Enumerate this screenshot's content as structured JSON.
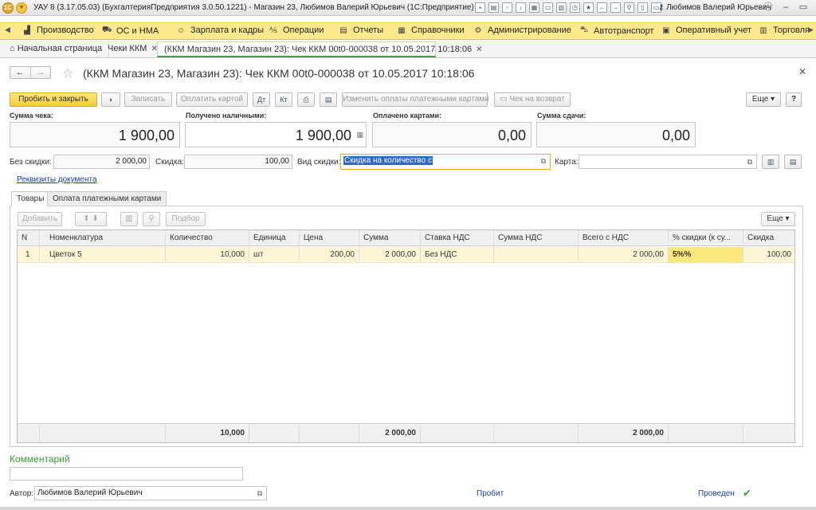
{
  "window": {
    "title": "УАУ 8 (3.17.05.03) (БухгалтерияПредприятия 3.0.50.1221) - Магазин 23, Любимов Валерий Юрьевич  (1С:Предприятие)",
    "user": "Любимов Валерий Юрьевич"
  },
  "sections": [
    {
      "label": "Производство",
      "icon": "factory-icon",
      "glyph": "▟"
    },
    {
      "label": "ОС и НМА",
      "icon": "truck-icon",
      "glyph": "⛟"
    },
    {
      "label": "Зарплата и кадры",
      "icon": "people-icon",
      "glyph": "☺"
    },
    {
      "label": "Операции",
      "icon": "operations-icon",
      "glyph": "⅍"
    },
    {
      "label": "Отчеты",
      "icon": "reports-icon",
      "glyph": "▤"
    },
    {
      "label": "Справочники",
      "icon": "books-icon",
      "glyph": "▦"
    },
    {
      "label": "Администрирование",
      "icon": "gear-icon",
      "glyph": "⚙"
    },
    {
      "label": "Автотранспорт",
      "icon": "car-icon",
      "glyph": "⛍"
    },
    {
      "label": "Оперативный учет",
      "icon": "accounting-icon",
      "glyph": "▣"
    },
    {
      "label": "Торговля",
      "icon": "trade-icon",
      "glyph": "▥"
    }
  ],
  "window_tabs": {
    "home": "Начальная страница",
    "checks": "Чеки ККМ",
    "current": "(ККМ Магазин 23, Магазин 23): Чек ККМ 00t0-000038 от 10.05.2017 10:18:06"
  },
  "form": {
    "title": "(ККМ Магазин 23, Магазин 23): Чек ККМ 00t0-000038 от 10.05.2017 10:18:06"
  },
  "toolbar": {
    "print_close": "Пробить и закрыть",
    "save": "Записать",
    "pay_card": "Оплатить картой",
    "change_card_payments": "Изменить оплаты платежными картами",
    "return_check": "Чек на возврат",
    "more": "Еще",
    "help": "?"
  },
  "sums": {
    "check_sum_label": "Сумма чека:",
    "check_sum": "1 900,00",
    "cash_label": "Получено наличными:",
    "cash": "1 900,00",
    "cards_label": "Оплачено картами:",
    "cards": "0,00",
    "change_label": "Сумма сдачи:",
    "change": "0,00"
  },
  "discounts": {
    "no_discount_label": "Без скидки:",
    "no_discount": "2 000,00",
    "discount_label": "Скидка:",
    "discount": "100,00",
    "type_label": "Вид скидки:",
    "type": "Скидка на количество с",
    "card_label": "Карта:",
    "card": ""
  },
  "requisites_link": "Реквизиты документа",
  "inner_tabs": {
    "goods": "Товары",
    "card_payments": "Оплата платежными картами"
  },
  "table_toolbar": {
    "add": "Добавить",
    "pick": "Подбор",
    "more": "Еще"
  },
  "table": {
    "columns": [
      "N",
      "Номенклатура",
      "Количество",
      "Единица",
      "Цена",
      "Сумма",
      "Ставка НДС",
      "Сумма НДС",
      "Всего с НДС",
      "% скидки (к су...",
      "Скидка"
    ],
    "rows": [
      [
        "1",
        "Цветок 5",
        "10,000",
        "шт",
        "200,00",
        "2 000,00",
        "Без НДС",
        "",
        "2 000,00",
        "5%%",
        "100,00"
      ]
    ],
    "totals": [
      "",
      "",
      "10,000",
      "",
      "",
      "2 000,00",
      "",
      "",
      "2 000,00",
      "",
      ""
    ]
  },
  "footer": {
    "comment_title": "Комментарий",
    "comment": "",
    "author_label": "Автор:",
    "author": "Любимов Валерий Юрьевич",
    "status_printed": "Пробит",
    "status_posted": "Проведен"
  }
}
